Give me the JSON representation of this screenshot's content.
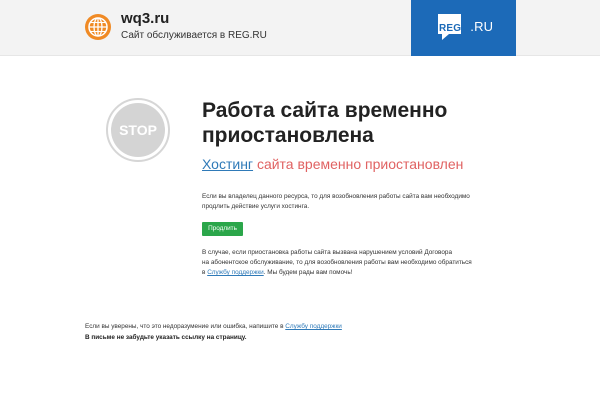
{
  "header": {
    "domain": "wq3.ru",
    "served_text": "Сайт обслуживается в REG.RU",
    "reg_logo": {
      "brand": "REG",
      "suffix": ".RU"
    },
    "brand_color": "#1c6ab8",
    "globe_icon_color": "#f08a24"
  },
  "main": {
    "stop_sign_text": "STOP",
    "title_line1": "Работа сайта временно",
    "title_line2": "приостановлена",
    "subtitle_link": "Хостинг",
    "subtitle_rest": "сайта временно приостановлен",
    "owner_line1": "Если вы владелец данного ресурса, то для возобновления работы сайта вам необходимо",
    "owner_line2": "продлить действие услуги хостинга.",
    "extend_button_label": "Продлить",
    "violation_line1": "В случае, если приостановка работы сайта вызвана нарушением условий Договора",
    "violation_line2": "на абонентское обслуживание, то для возобновления работы вам необходимо обратиться",
    "violation_line3_prefix": "в",
    "violation_support_link": "Службу поддержки",
    "violation_line3_suffix": ". Мы будем рады вам помочь!"
  },
  "footer": {
    "line1_prefix": "Если вы уверены, что это недоразумение или ошибка, напишите в",
    "support_link": "Службу поддержки",
    "line2": "В письме не забудьте указать ссылку на страницу."
  },
  "colors": {
    "subtitle": "#e06262",
    "link": "#2f7ab8",
    "button": "#2ba64a",
    "stop_sign": "#d4d4d4"
  }
}
